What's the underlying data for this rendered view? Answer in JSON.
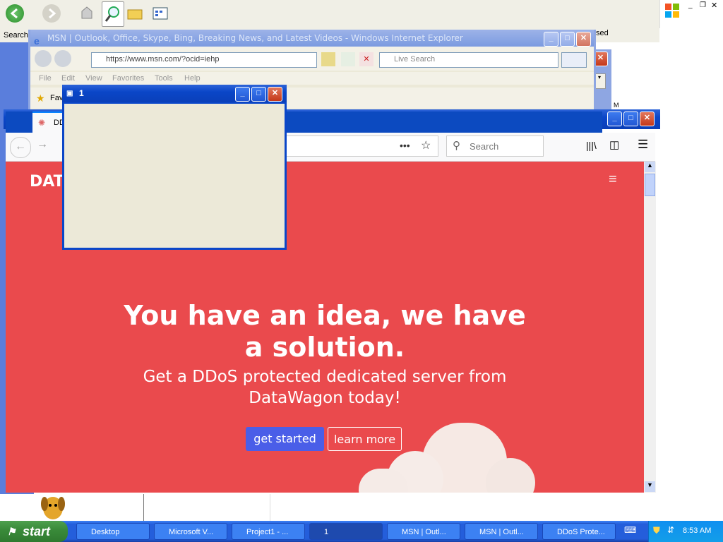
{
  "explorer": {
    "search_label": "Search",
    "right_text": "sed"
  },
  "ie": {
    "title": "MSN | Outlook, Office, Skype, Bing, Breaking News, and Latest Videos - Windows Internet Explorer",
    "url": "https://www.msn.com/?ocid=iehp",
    "search_placeholder": "Live Search",
    "menu": [
      "File",
      "Edit",
      "View",
      "Favorites",
      "Tools",
      "Help"
    ],
    "favorites_label": "Fav"
  },
  "win1": {
    "title": "1"
  },
  "firefox": {
    "tab_label": "DD",
    "search_placeholder": "Search",
    "brand_partial": "DAT",
    "hero_title": "You have an idea, we have a solution.",
    "hero_subtitle": "Get a DDoS protected dedicated server from DataWagon today!",
    "get_started": "get started",
    "learn_more": "learn more",
    "hero_bg": "#ea4a4d",
    "primary_btn": "#4a5ee8"
  },
  "taskbar": {
    "start": "start",
    "items": [
      "Desktop",
      "Microsoft V...",
      "Project1 - ...",
      "1",
      "MSN | Outl...",
      "MSN | Outl...",
      "DDoS Prote..."
    ],
    "clock": "8:53 AM"
  }
}
